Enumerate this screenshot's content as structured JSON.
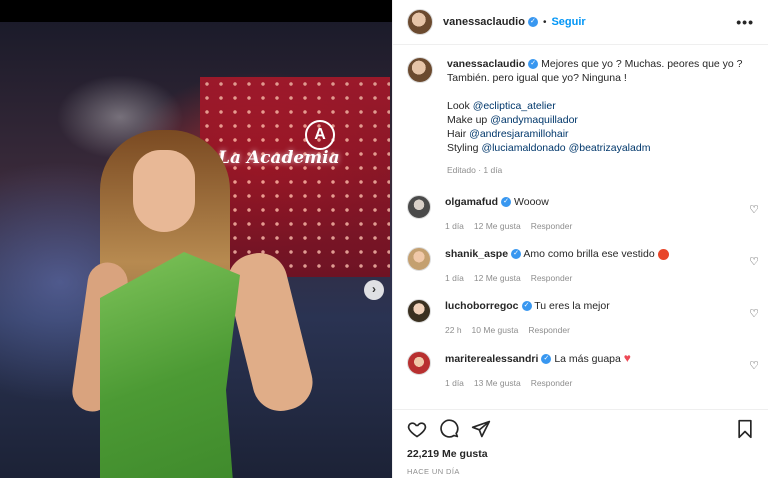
{
  "post": {
    "username": "vanessaclaudio",
    "follow_label": "Seguir",
    "dot": "•",
    "more_label": "•••",
    "next_label": "›",
    "logo_letter": "A",
    "logo_text": "La Academia"
  },
  "caption": {
    "username": "vanessaclaudio",
    "line1": "Mejores que yo ? Muchas. peores que yo ?",
    "line2": "También. pero igual que yo? Ninguna !",
    "credits": [
      {
        "prefix": "Look ",
        "mention": "@ecliptica_atelier"
      },
      {
        "prefix": "Make up ",
        "mention": "@andymaquillador"
      },
      {
        "prefix": "Hair ",
        "mention": "@andresjaramillohair"
      },
      {
        "prefix": "Styling ",
        "mention": "@luciamaldonado",
        "mention2": "@beatrizayaladm"
      }
    ],
    "meta": "Editado · 1 día"
  },
  "comments": [
    {
      "username": "olgamafud",
      "text": "Wooow",
      "time": "1 día",
      "likes": "12 Me gusta",
      "reply": "Responder"
    },
    {
      "username": "shanik_aspe",
      "text": "Amo como brilla ese vestido",
      "time": "1 día",
      "likes": "12 Me gusta",
      "reply": "Responder",
      "emoji_color": "#e8462a"
    },
    {
      "username": "luchoborregoc",
      "text": "Tu eres la mejor",
      "time": "22 h",
      "likes": "10 Me gusta",
      "reply": "Responder"
    },
    {
      "username": "mariterealessandri",
      "text": "La más guapa",
      "time": "1 día",
      "likes": "13 Me gusta",
      "reply": "Responder",
      "emoji": "♥",
      "emoji_color": "#ed4956"
    }
  ],
  "footer": {
    "likes": "22,219 Me gusta",
    "ago": "HACE UN DÍA"
  },
  "colors": {
    "link_blue": "#0095f6",
    "mention_blue": "#00376b",
    "verified_blue": "#3897f0",
    "muted": "#8e8e8e"
  },
  "icons": [
    "verified-icon",
    "more-options-icon",
    "heart-icon",
    "comment-icon",
    "share-icon",
    "bookmark-icon",
    "next-arrow-icon"
  ]
}
